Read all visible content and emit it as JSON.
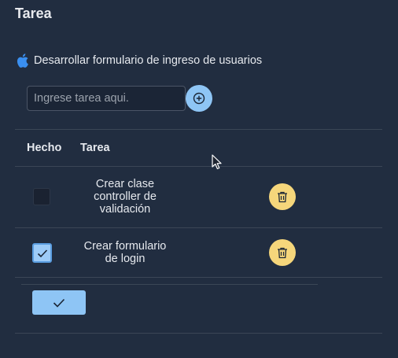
{
  "page": {
    "title": "Tarea"
  },
  "project": {
    "name": "Desarrollar formulario de ingreso de usuarios",
    "icon": "apple-icon"
  },
  "new_task": {
    "placeholder": "Ingrese tarea aqui.",
    "value": "",
    "add_icon": "plus-circle-icon"
  },
  "table": {
    "headers": {
      "done": "Hecho",
      "task": "Tarea"
    },
    "rows": [
      {
        "task_lines": [
          "Crear clase",
          "controller de",
          "validación"
        ],
        "done": false,
        "delete_icon": "trash-icon"
      },
      {
        "task_lines": [
          "Crear formulario",
          "de login"
        ],
        "done": true,
        "delete_icon": "trash-icon"
      }
    ]
  },
  "confirm": {
    "icon": "check-icon"
  },
  "colors": {
    "background": "#212d40",
    "primary": "#8ec5f5",
    "warning": "#f5d67b",
    "divider": "#3b4656"
  }
}
